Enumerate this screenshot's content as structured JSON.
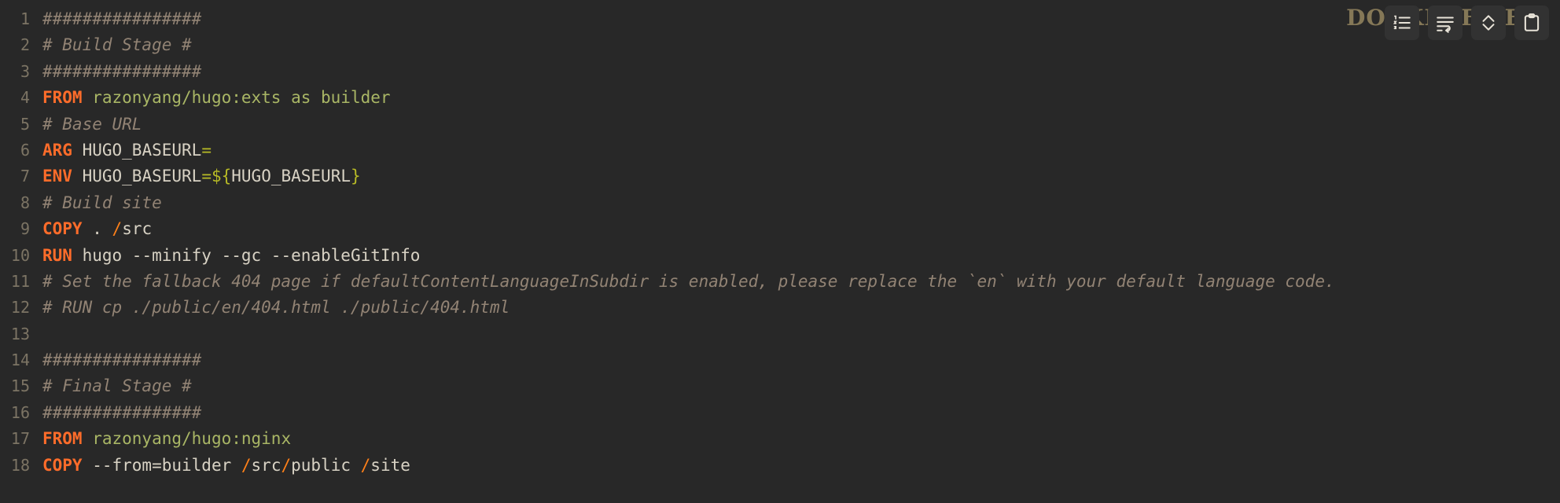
{
  "viewer": {
    "background": "#282828",
    "language_label": "DOCKERFILE",
    "total_lines": 18
  },
  "toolbar": {
    "buttons": [
      {
        "name": "toggle-line-numbers-button",
        "icon": "list-ordered-icon",
        "label": "Toggle line numbers"
      },
      {
        "name": "toggle-word-wrap-button",
        "icon": "word-wrap-icon",
        "label": "Toggle word wrap"
      },
      {
        "name": "toggle-expand-button",
        "icon": "chevron-expand-icon",
        "label": "Expand / collapse"
      },
      {
        "name": "copy-button",
        "icon": "clipboard-icon",
        "label": "Copy"
      }
    ]
  },
  "colors": {
    "background": "#282828",
    "line_number": "#7c7464",
    "comment": "#928374",
    "keyword": "#fe6c2a",
    "string": "#a9b665",
    "plain": "#d8d2c4",
    "operator": "#b8bb26",
    "slash": "#fe8019",
    "button_background": "#323232",
    "icon": "#e8e3d8",
    "language_label": "#8a7d5a"
  },
  "code": {
    "language": "dockerfile",
    "lines": [
      {
        "n": 1,
        "text": "################"
      },
      {
        "n": 2,
        "text": "# Build Stage #"
      },
      {
        "n": 3,
        "text": "################"
      },
      {
        "n": 4,
        "text": "FROM razonyang/hugo:exts as builder"
      },
      {
        "n": 5,
        "text": "# Base URL"
      },
      {
        "n": 6,
        "text": "ARG HUGO_BASEURL="
      },
      {
        "n": 7,
        "text": "ENV HUGO_BASEURL=${HUGO_BASEURL}"
      },
      {
        "n": 8,
        "text": "# Build site"
      },
      {
        "n": 9,
        "text": "COPY . /src"
      },
      {
        "n": 10,
        "text": "RUN hugo --minify --gc --enableGitInfo"
      },
      {
        "n": 11,
        "text": "# Set the fallback 404 page if defaultContentLanguageInSubdir is enabled, please replace the `en` with your default language code."
      },
      {
        "n": 12,
        "text": "# RUN cp ./public/en/404.html ./public/404.html"
      },
      {
        "n": 13,
        "text": ""
      },
      {
        "n": 14,
        "text": "################"
      },
      {
        "n": 15,
        "text": "# Final Stage #"
      },
      {
        "n": 16,
        "text": "################"
      },
      {
        "n": 17,
        "text": "FROM razonyang/hugo:nginx"
      },
      {
        "n": 18,
        "text": "COPY --from=builder /src/public /site"
      }
    ],
    "numbers": [
      "1",
      "2",
      "3",
      "4",
      "5",
      "6",
      "7",
      "8",
      "9",
      "10",
      "11",
      "12",
      "13",
      "14",
      "15",
      "16",
      "17",
      "18"
    ],
    "tokens": [
      [
        {
          "t": "################",
          "c": "cm"
        }
      ],
      [
        {
          "t": "# Build Stage #",
          "c": "cm"
        }
      ],
      [
        {
          "t": "################",
          "c": "cm"
        }
      ],
      [
        {
          "t": "FROM",
          "c": "kw"
        },
        {
          "t": " razonyang/hugo:exts as builder",
          "c": "str"
        }
      ],
      [
        {
          "t": "# Base URL",
          "c": "cm"
        }
      ],
      [
        {
          "t": "ARG",
          "c": "kw"
        },
        {
          "t": " HUGO_BASEURL",
          "c": "pln"
        },
        {
          "t": "=",
          "c": "op"
        }
      ],
      [
        {
          "t": "ENV",
          "c": "kw"
        },
        {
          "t": " HUGO_BASEURL",
          "c": "pln"
        },
        {
          "t": "=",
          "c": "op"
        },
        {
          "t": "${",
          "c": "op"
        },
        {
          "t": "HUGO_BASEURL",
          "c": "pln"
        },
        {
          "t": "}",
          "c": "op"
        }
      ],
      [
        {
          "t": "# Build site",
          "c": "cm"
        }
      ],
      [
        {
          "t": "COPY",
          "c": "kw"
        },
        {
          "t": " ",
          "c": "pln"
        },
        {
          "t": ".",
          "c": "dot"
        },
        {
          "t": " ",
          "c": "pln"
        },
        {
          "t": "/",
          "c": "sl"
        },
        {
          "t": "src",
          "c": "pth"
        }
      ],
      [
        {
          "t": "RUN",
          "c": "kw"
        },
        {
          "t": " hugo --minify --gc --enableGitInfo",
          "c": "pln"
        }
      ],
      [
        {
          "t": "# Set the fallback 404 page if defaultContentLanguageInSubdir is enabled, please replace the `en` with your default language code.",
          "c": "cm"
        }
      ],
      [
        {
          "t": "# RUN cp ./public/en/404.html ./public/404.html",
          "c": "cm"
        }
      ],
      [
        {
          "t": "",
          "c": "pln"
        }
      ],
      [
        {
          "t": "################",
          "c": "cm"
        }
      ],
      [
        {
          "t": "# Final Stage #",
          "c": "cm"
        }
      ],
      [
        {
          "t": "################",
          "c": "cm"
        }
      ],
      [
        {
          "t": "FROM",
          "c": "kw"
        },
        {
          "t": " razonyang/hugo:nginx",
          "c": "str"
        }
      ],
      [
        {
          "t": "COPY",
          "c": "kw"
        },
        {
          "t": " --from=builder ",
          "c": "pln"
        },
        {
          "t": "/",
          "c": "sl"
        },
        {
          "t": "src",
          "c": "pth"
        },
        {
          "t": "/",
          "c": "sl"
        },
        {
          "t": "public",
          "c": "pth"
        },
        {
          "t": " ",
          "c": "pln"
        },
        {
          "t": "/",
          "c": "sl"
        },
        {
          "t": "site",
          "c": "pth"
        }
      ]
    ]
  }
}
